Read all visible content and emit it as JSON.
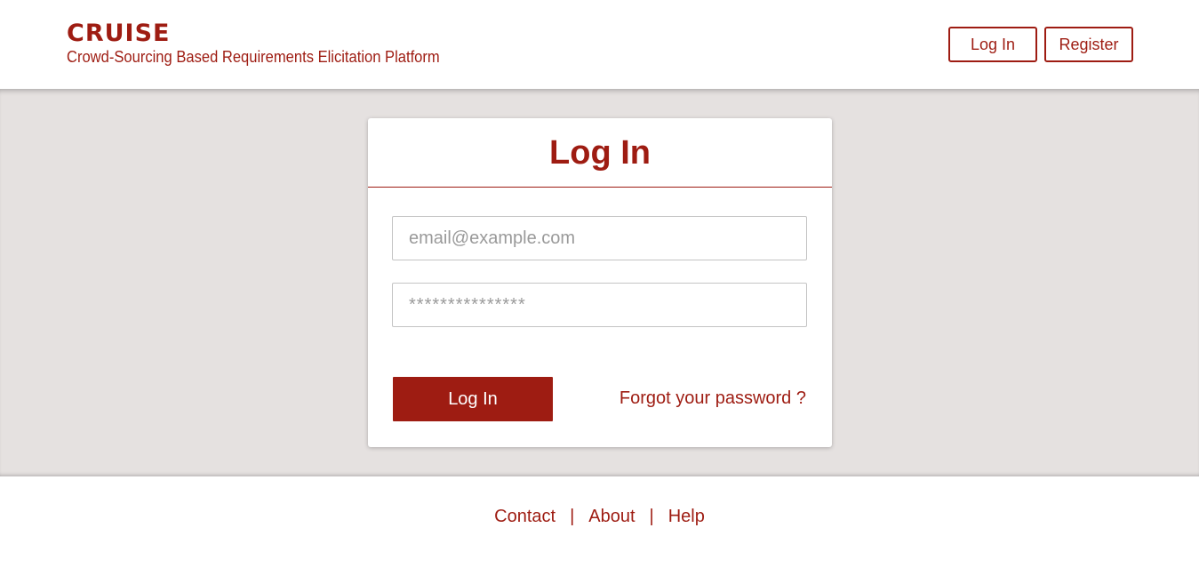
{
  "header": {
    "brand": "CRUISE",
    "subtitle": "Crowd-Sourcing Based Requirements Elicitation Platform",
    "login_label": "Log In",
    "register_label": "Register"
  },
  "login_card": {
    "title": "Log In",
    "email_placeholder": "email@example.com",
    "password_placeholder": "***************",
    "submit_label": "Log In",
    "forgot_password": "Forgot your password ?"
  },
  "footer": {
    "links": [
      "Contact",
      "About",
      "Help"
    ],
    "separator": "|"
  },
  "colors": {
    "brand": "#9e1c12",
    "background": "#e5e1e0"
  }
}
